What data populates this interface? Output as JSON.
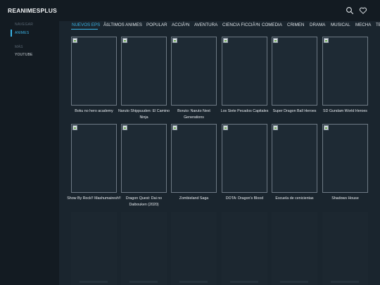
{
  "header": {
    "brand": "REANIMESPLUS",
    "icons": [
      "search-icon",
      "heart-icon"
    ]
  },
  "sidebar": {
    "sections": [
      {
        "title": "NAVEGAR",
        "items": [
          {
            "label": "ANIMES",
            "active": true
          }
        ]
      },
      {
        "title": "MÁS",
        "items": [
          {
            "label": "YOUTUBE",
            "active": false
          }
        ]
      }
    ]
  },
  "genres": [
    "NUEVOS EPS",
    "ÃšLTIMOS ANIMES",
    "POPULAR",
    "ACCIÃ³N",
    "AVENTURA",
    "CIENCIA FICCIÃ³N",
    "COMEDIA",
    "CRIMEN",
    "DRAMA",
    "MUSICAL",
    "MECHA",
    "TE"
  ],
  "active_genre": "NUEVOS EPS",
  "grid": [
    {
      "title": "Boku no hero academy"
    },
    {
      "title": "Naruto Shippuuden: El Camino Ninja"
    },
    {
      "title": "Boruto: Naruto Next Generations"
    },
    {
      "title": "Los Siete Pecados Capitales"
    },
    {
      "title": "Super Dragon Ball Heroes"
    },
    {
      "title": "SD Gundam World Heroes"
    },
    {
      "title": "Show By Rock!! Mashumairesh!!"
    },
    {
      "title": "Dragon Quest: Dai no Daibouken (2020)"
    },
    {
      "title": "Zombieland Saga"
    },
    {
      "title": "DOTA: Dragon's Blood"
    },
    {
      "title": "Escuela de cenicientas"
    },
    {
      "title": "Shadows House"
    }
  ],
  "colors": {
    "accent": "#3ab4e6",
    "background": "#1a252e",
    "sidebar": "#131b22"
  }
}
